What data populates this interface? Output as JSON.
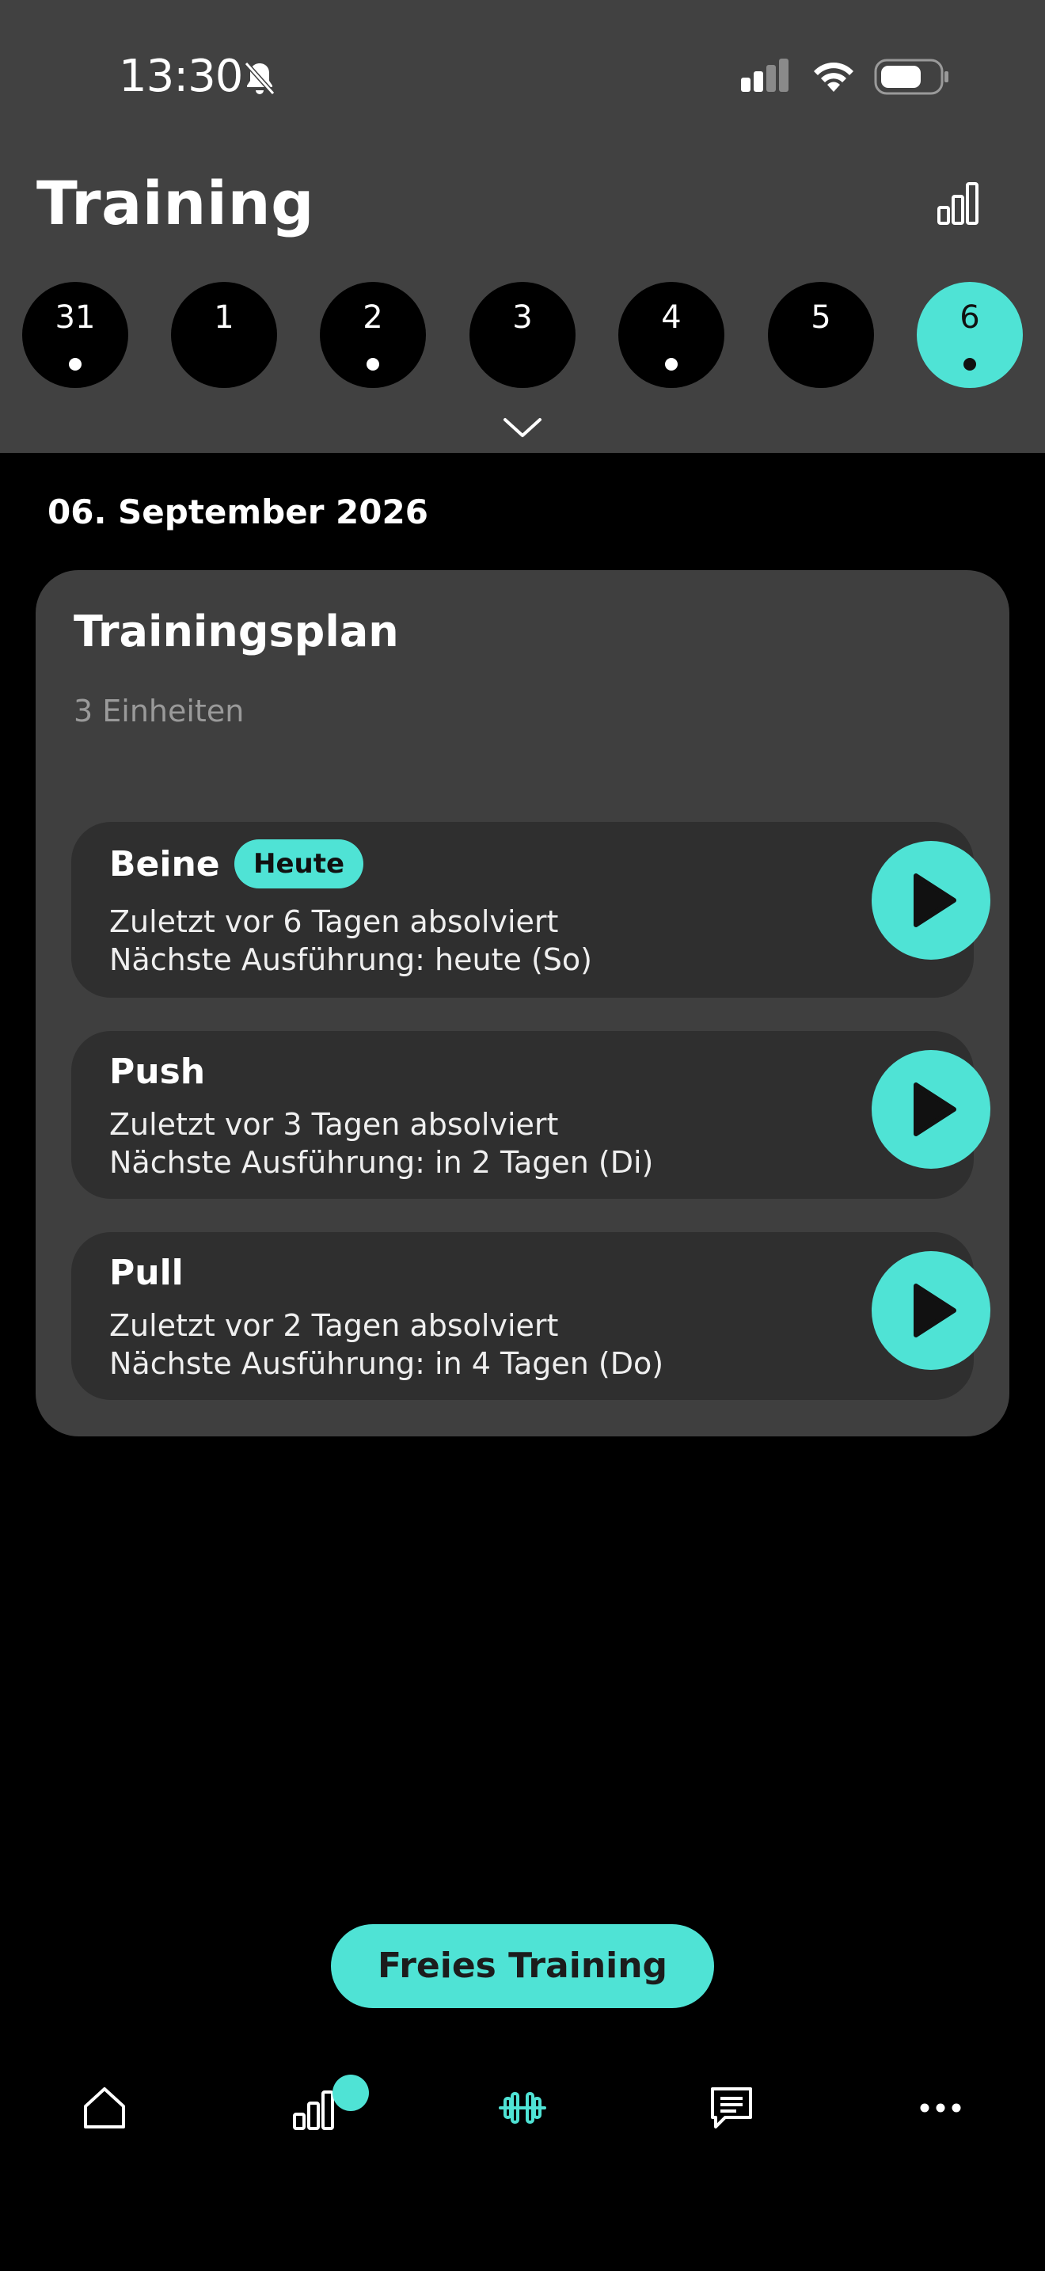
{
  "status_bar": {
    "time": "13:30",
    "icons": [
      "bell-muted-icon",
      "cellular-signal-icon",
      "wifi-icon",
      "battery-icon"
    ]
  },
  "header": {
    "title": "Training",
    "stats_icon": "bar-chart-icon"
  },
  "calendar": {
    "days": [
      {
        "label": "31",
        "has_dot": true,
        "active": false
      },
      {
        "label": "1",
        "has_dot": false,
        "active": false
      },
      {
        "label": "2",
        "has_dot": true,
        "active": false
      },
      {
        "label": "3",
        "has_dot": false,
        "active": false
      },
      {
        "label": "4",
        "has_dot": true,
        "active": false
      },
      {
        "label": "5",
        "has_dot": false,
        "active": false
      },
      {
        "label": "6",
        "has_dot": true,
        "active": true
      }
    ],
    "expand_icon": "chevron-down-icon"
  },
  "date_heading": "06. September 2026",
  "plan": {
    "title": "Trainingsplan",
    "subtitle": "3 Einheiten",
    "sessions": [
      {
        "name": "Beine",
        "badge": "Heute",
        "last": "Zuletzt vor 6 Tagen absolviert",
        "next": "Nächste Ausführung: heute (So)"
      },
      {
        "name": "Push",
        "badge": "",
        "last": "Zuletzt vor 3 Tagen absolviert",
        "next": "Nächste Ausführung: in 2 Tagen (Di)"
      },
      {
        "name": "Pull",
        "badge": "",
        "last": "Zuletzt vor 2 Tagen absolviert",
        "next": "Nächste Ausführung: in 4 Tagen (Do)"
      }
    ]
  },
  "free_training_label": "Freies Training",
  "tabbar": {
    "items": [
      "home-icon",
      "stats-icon",
      "dumbbell-icon",
      "chat-icon",
      "more-icon"
    ],
    "active": "dumbbell-icon"
  },
  "colors": {
    "accent": "#4fe3d5",
    "header_bg": "#414141",
    "card_bg": "#3f3f3f",
    "session_bg": "#2f2f2f",
    "background": "#000000"
  }
}
